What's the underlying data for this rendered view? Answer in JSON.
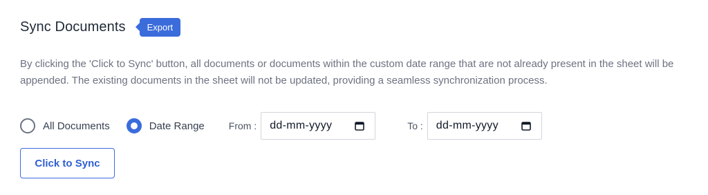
{
  "section": {
    "title": "Sync Documents",
    "badge": "Export",
    "description": "By clicking the 'Click to Sync' button, all documents or documents within the custom date range that are not already present in the sheet will be appended. The existing documents in the sheet will not be updated, providing a seamless synchronization process."
  },
  "options": {
    "all_documents_label": "All Documents",
    "date_range_label": "Date Range",
    "selected": "Date Range"
  },
  "date_range": {
    "from_label": "From :",
    "from_value": "dd-mm-yyyy",
    "to_label": "To :",
    "to_value": "dd-mm-yyyy"
  },
  "actions": {
    "sync_button": "Click to Sync"
  },
  "colors": {
    "accent": "#3b6cdc",
    "text_muted": "#6b7280"
  }
}
